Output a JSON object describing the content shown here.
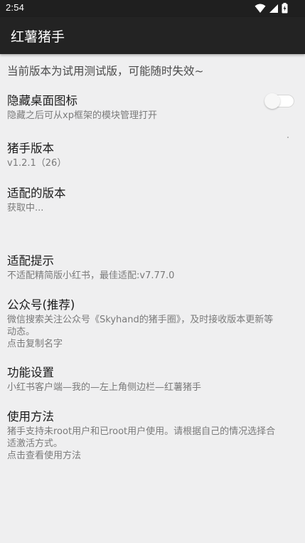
{
  "status_bar": {
    "time": "2:54",
    "icons": [
      "wifi-icon",
      "signal-icon",
      "battery-icon"
    ]
  },
  "app_bar": {
    "title": "红薯猪手"
  },
  "notice": "当前版本为试用测试版，可能随时失效~",
  "preferences": [
    {
      "title": "隐藏桌面图标",
      "summary": "隐藏之后可从xp框架的模块管理打开",
      "toggle": {
        "on": false
      }
    },
    {
      "title": "猪手版本",
      "summary": "v1.2.1（26）"
    },
    {
      "title": "适配的版本",
      "summary": "获取中..."
    },
    {
      "title": "适配提示",
      "summary": "不适配精简版小红书，最佳适配:v7.77.0"
    },
    {
      "title": "公众号(推荐)",
      "summary": "微信搜索关注公众号《Skyhand的猪手圈》，及时接收版本更新等\n动态。\n点击复制名字"
    },
    {
      "title": "功能设置",
      "summary": "小红书客户端—我的—左上角侧边栏—红薯猪手"
    },
    {
      "title": "使用方法",
      "summary": "猪手支持未root用户和已root用户使用。请根据自己的情况选择合\n适激活方式。\n点击查看使用方法"
    }
  ],
  "colors": {
    "status_bar": "#1f1f1f",
    "app_bar": "#232323",
    "background": "#efeff0",
    "title_text": "#1b1b1b",
    "summary_text": "#7a7a7a"
  }
}
